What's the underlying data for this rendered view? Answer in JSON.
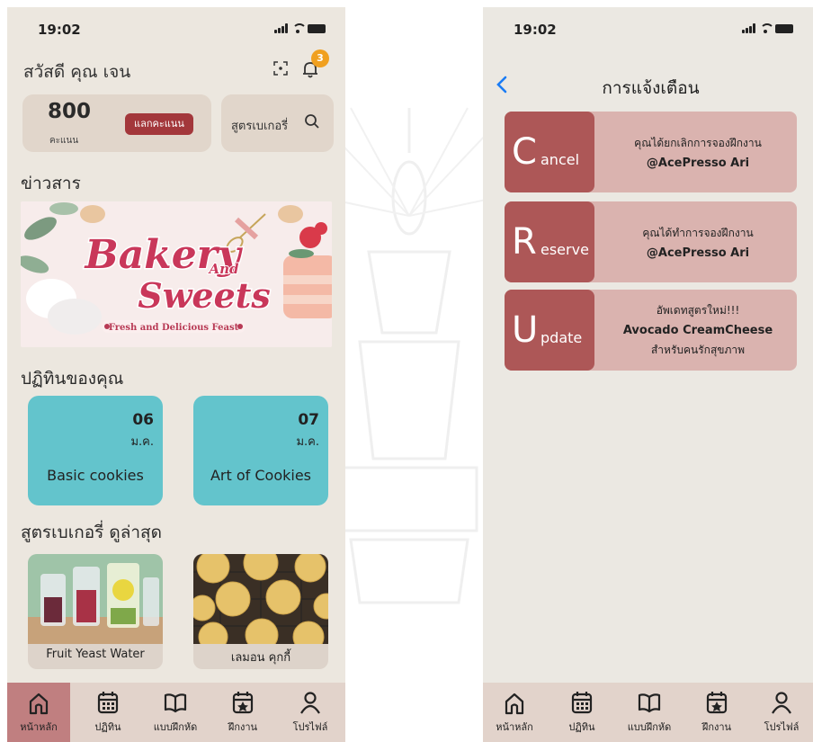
{
  "status": {
    "time": "19:02"
  },
  "home": {
    "greeting": "สวัสดี คุณ เจน",
    "notification_count": "3",
    "points": {
      "value": "800",
      "unit": "คะแนน",
      "redeem_label": "แลกคะแนน"
    },
    "search_label": "สูตรเบเกอรี่",
    "news_title": "ข่าวสาร",
    "banner": {
      "line1": "Bakery",
      "and": "And",
      "line2": "Sweets",
      "tagline": "Fresh and Delicious Feast"
    },
    "schedule_title": "ปฏิทินของคุณ",
    "classes": [
      {
        "day": "06",
        "month": "ม.ค.",
        "name": "Basic cookies"
      },
      {
        "day": "07",
        "month": "ม.ค.",
        "name": "Art of Cookies"
      }
    ],
    "recipes_title": "สูตรเบเกอรี่ ดูล่าสุด",
    "recipes": [
      {
        "name": "Fruit Yeast Water"
      },
      {
        "name": "เลมอน คุกกี้"
      }
    ]
  },
  "nav": [
    {
      "label": "หน้าหลัก",
      "icon": "home-icon"
    },
    {
      "label": "ปฏิทิน",
      "icon": "calendar-icon"
    },
    {
      "label": "แบบฝึกหัด",
      "icon": "book-icon"
    },
    {
      "label": "ฝึกงาน",
      "icon": "internship-icon"
    },
    {
      "label": "โปรไฟล์",
      "icon": "profile-icon"
    }
  ],
  "notifications": {
    "title": "การแจ้งเตือน",
    "items": [
      {
        "letter": "C",
        "rest": "ancel",
        "line1": "คุณได้ยกเลิกการจองฝึกงาน",
        "line2": "@AcePresso Ari",
        "line3": ""
      },
      {
        "letter": "R",
        "rest": "eserve",
        "line1": "คุณได้ทำการจองฝึกงาน",
        "line2": "@AcePresso Ari",
        "line3": ""
      },
      {
        "letter": "U",
        "rest": "pdate",
        "line1": "อัพเดทสูตรใหม่!!!",
        "line2": "Avocado CreamCheese",
        "line3": "สำหรับคนรักสุขภาพ"
      }
    ]
  },
  "colors": {
    "accent_red": "#a3373b",
    "teal": "#63c4cc",
    "notif_dark": "#ad5757",
    "notif_light": "#dab3af",
    "ios_blue": "#1a7cf5"
  }
}
